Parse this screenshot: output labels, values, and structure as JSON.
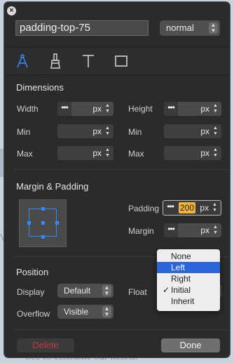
{
  "background": {
    "text": "See to consume our hearts.",
    "mark": "V"
  },
  "header": {
    "element_name": "padding-top-75",
    "state_select": "normal"
  },
  "toolbar": {
    "tools": [
      "style-tool-icon",
      "brush-tool-icon",
      "text-tool-icon",
      "box-tool-icon"
    ],
    "active_color": "#3b8cff"
  },
  "dimensions": {
    "title": "Dimensions",
    "width_label": "Width",
    "height_label": "Height",
    "min_label": "Min",
    "max_label": "Max",
    "unit": "px",
    "dots": "•••"
  },
  "margin_padding": {
    "title": "Margin & Padding",
    "padding_label": "Padding",
    "padding_value": "200",
    "padding_unit": "px",
    "margin_label": "Margin",
    "margin_unit": "px"
  },
  "position": {
    "title": "Position",
    "display_label": "Display",
    "display_value": "Default",
    "float_label": "Float",
    "overflow_label": "Overflow",
    "overflow_value": "Visible"
  },
  "float_dropdown": {
    "options": [
      "None",
      "Left",
      "Right",
      "Initial",
      "Inherit"
    ],
    "highlighted": "Left",
    "checked": "Initial",
    "check_mark": "✓"
  },
  "footer": {
    "delete_label": "Delete",
    "done_label": "Done"
  },
  "colors": {
    "panel_bg": "#2b2b2b",
    "accent": "#2f8cff",
    "padding_highlight": "#f2b339",
    "delete_text": "#c23a3a"
  }
}
